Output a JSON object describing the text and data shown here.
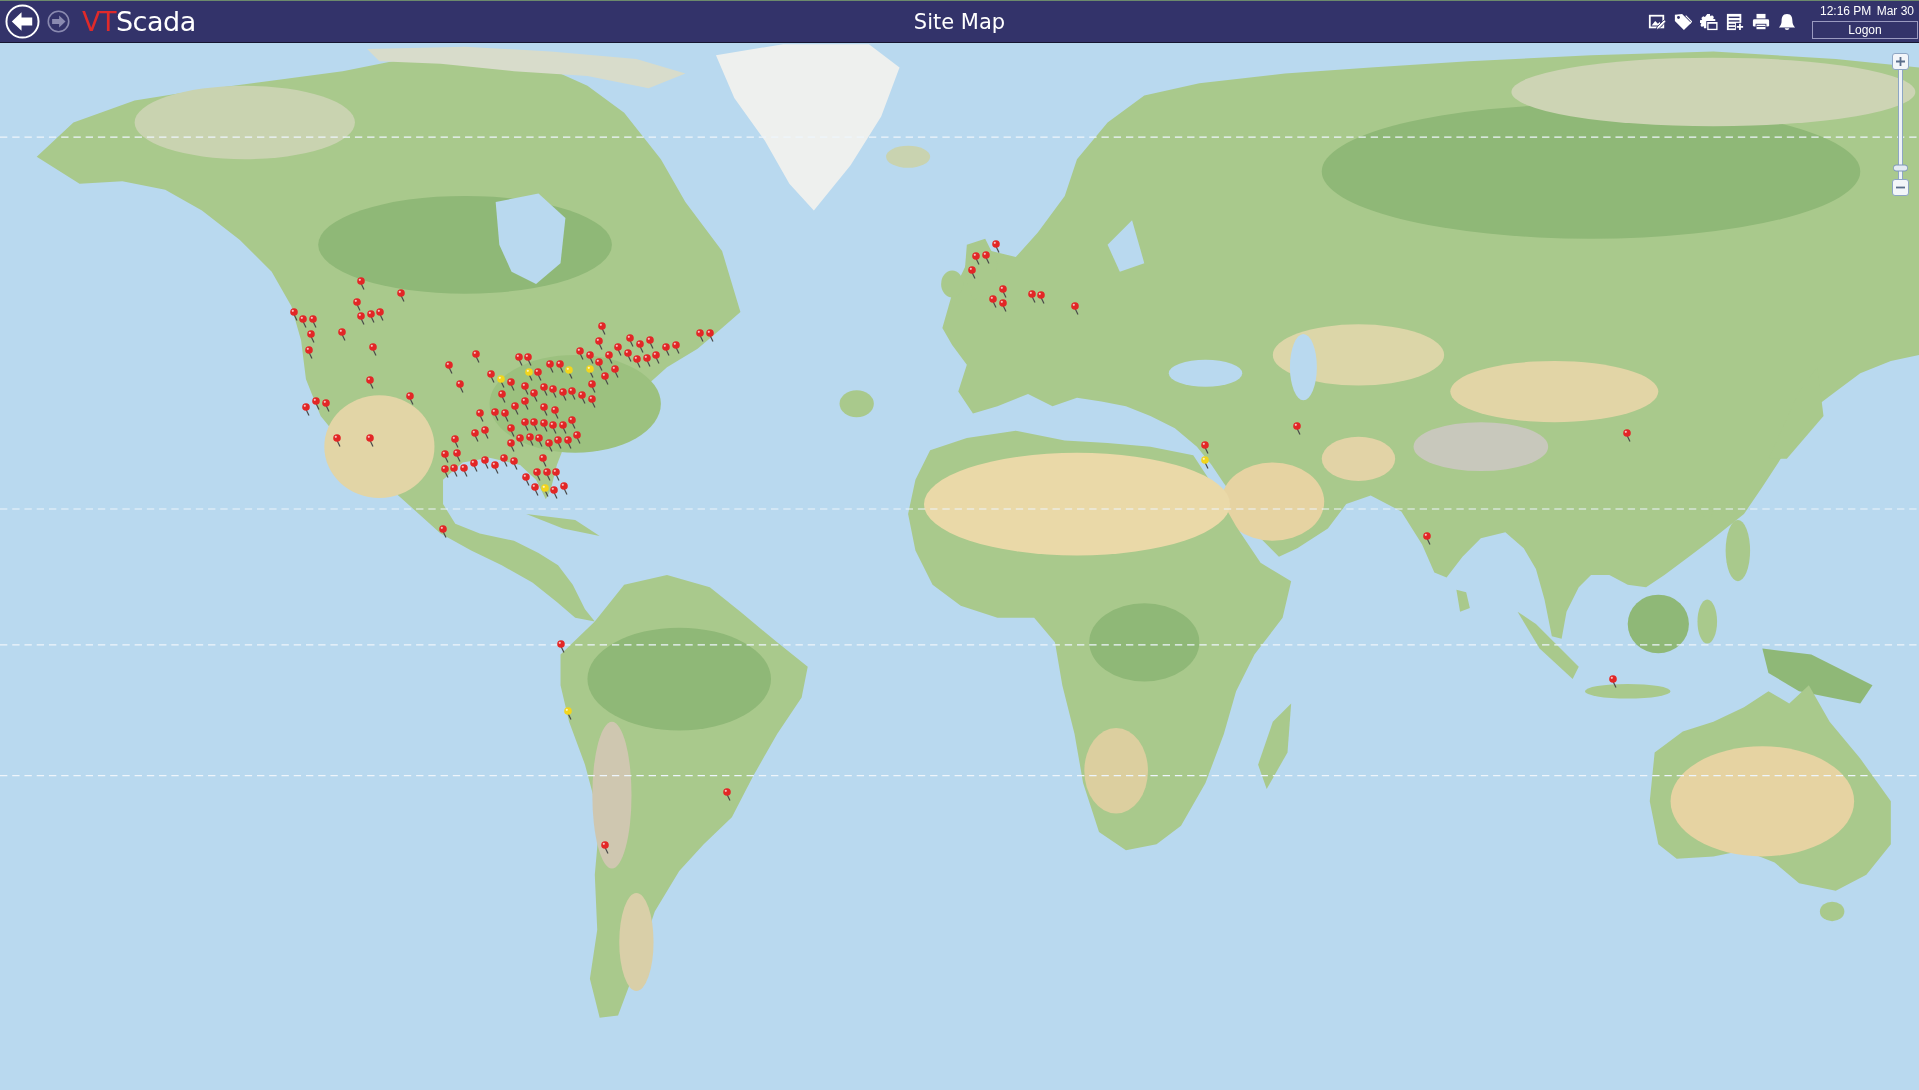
{
  "header": {
    "nav": [
      {
        "kind": "back",
        "disabled": false
      },
      {
        "kind": "forward",
        "disabled": true
      }
    ],
    "logo": {
      "mark": "VT",
      "name": "Scada"
    },
    "title": "Site Map",
    "toolbar": [
      {
        "kind": "picture-edit"
      },
      {
        "kind": "tag"
      },
      {
        "kind": "settings"
      },
      {
        "kind": "list-add"
      },
      {
        "kind": "print"
      },
      {
        "kind": "bell"
      }
    ],
    "time": "12:16 PM",
    "date": "Mar 30",
    "logon": "Logon"
  },
  "map": {
    "zoom": {
      "level": 0.1
    },
    "sites": [
      {
        "color": "#f2d51c"
      },
      {
        "color": "#f2d51c"
      },
      {
        "color": "#f2d51c"
      },
      {
        "color": "#f2d51c"
      },
      {
        "color": "#f2d51c"
      },
      {
        "color": "#f2d51c"
      },
      {
        "color": "#f2d51c"
      },
      {
        "color": "#e32626"
      },
      {
        "color": "#e32626"
      },
      {
        "color": "#e32626"
      },
      {
        "color": "#e32626"
      },
      {
        "color": "#e32626"
      },
      {
        "color": "#e32626"
      },
      {
        "color": "#e32626"
      },
      {
        "color": "#e32626"
      },
      {
        "color": "#e32626"
      },
      {
        "color": "#e32626"
      },
      {
        "color": "#e32626"
      },
      {
        "color": "#e32626"
      },
      {
        "color": "#e32626"
      },
      {
        "color": "#e32626"
      },
      {
        "color": "#e32626"
      },
      {
        "color": "#e32626"
      },
      {
        "color": "#e32626"
      },
      {
        "color": "#e32626"
      },
      {
        "color": "#e32626"
      },
      {
        "color": "#e32626"
      },
      {
        "color": "#e32626"
      },
      {
        "color": "#e32626"
      },
      {
        "color": "#e32626"
      },
      {
        "color": "#e32626"
      },
      {
        "color": "#e32626"
      },
      {
        "color": "#e32626"
      },
      {
        "color": "#e32626"
      },
      {
        "color": "#e32626"
      },
      {
        "color": "#e32626"
      },
      {
        "color": "#e32626"
      },
      {
        "color": "#e32626"
      },
      {
        "color": "#e32626"
      },
      {
        "color": "#e32626"
      },
      {
        "color": "#e32626"
      },
      {
        "color": "#e32626"
      },
      {
        "color": "#e32626"
      },
      {
        "color": "#e32626"
      },
      {
        "color": "#e32626"
      },
      {
        "color": "#e32626"
      },
      {
        "color": "#e32626"
      },
      {
        "color": "#e32626"
      },
      {
        "color": "#e32626"
      },
      {
        "color": "#e32626"
      },
      {
        "color": "#e32626"
      },
      {
        "color": "#e32626"
      },
      {
        "color": "#e32626"
      },
      {
        "color": "#e32626"
      },
      {
        "color": "#e32626"
      },
      {
        "color": "#e32626"
      },
      {
        "color": "#e32626"
      },
      {
        "color": "#e32626"
      },
      {
        "color": "#e32626"
      },
      {
        "color": "#e32626"
      },
      {
        "color": "#e32626"
      },
      {
        "color": "#e32626"
      },
      {
        "color": "#e32626"
      },
      {
        "color": "#e32626"
      },
      {
        "color": "#e32626"
      },
      {
        "color": "#e32626"
      },
      {
        "color": "#e32626"
      },
      {
        "color": "#e32626"
      },
      {
        "color": "#e32626"
      },
      {
        "color": "#e32626"
      },
      {
        "color": "#e32626"
      },
      {
        "color": "#e32626"
      },
      {
        "color": "#e32626"
      },
      {
        "color": "#e32626"
      },
      {
        "color": "#e32626"
      },
      {
        "color": "#e32626"
      },
      {
        "color": "#e32626"
      },
      {
        "color": "#e32626"
      },
      {
        "color": "#e32626"
      },
      {
        "color": "#e32626"
      },
      {
        "color": "#e32626"
      },
      {
        "color": "#e32626"
      },
      {
        "color": "#e32626"
      },
      {
        "color": "#e32626"
      },
      {
        "color": "#e32626"
      },
      {
        "color": "#e32626"
      },
      {
        "color": "#e32626"
      },
      {
        "color": "#e32626"
      },
      {
        "color": "#e32626"
      },
      {
        "color": "#e32626"
      },
      {
        "color": "#e32626"
      },
      {
        "color": "#e32626"
      },
      {
        "color": "#e32626"
      },
      {
        "color": "#e32626"
      },
      {
        "color": "#e32626"
      },
      {
        "color": "#e32626"
      },
      {
        "color": "#e32626"
      },
      {
        "color": "#e32626"
      },
      {
        "color": "#e32626"
      },
      {
        "color": "#e32626"
      },
      {
        "color": "#e32626"
      },
      {
        "color": "#e32626"
      },
      {
        "color": "#e32626"
      },
      {
        "color": "#e32626"
      },
      {
        "color": "#e32626"
      },
      {
        "color": "#e32626"
      },
      {
        "color": "#e32626"
      },
      {
        "color": "#e32626"
      },
      {
        "color": "#e32626"
      },
      {
        "color": "#e32626"
      },
      {
        "color": "#e32626"
      },
      {
        "color": "#e32626"
      },
      {
        "color": "#e32626"
      },
      {
        "color": "#e32626"
      },
      {
        "color": "#e32626"
      },
      {
        "color": "#e32626"
      },
      {
        "color": "#e32626"
      },
      {
        "color": "#e32626"
      },
      {
        "color": "#e32626"
      },
      {
        "color": "#e32626"
      },
      {
        "color": "#e32626"
      },
      {
        "color": "#e32626"
      },
      {
        "color": "#e32626"
      },
      {
        "color": "#e32626"
      },
      {
        "color": "#e32626"
      },
      {
        "color": "#e32626"
      },
      {
        "color": "#e32626"
      },
      {
        "color": "#e32626"
      },
      {
        "color": "#e32626"
      }
    ]
  }
}
